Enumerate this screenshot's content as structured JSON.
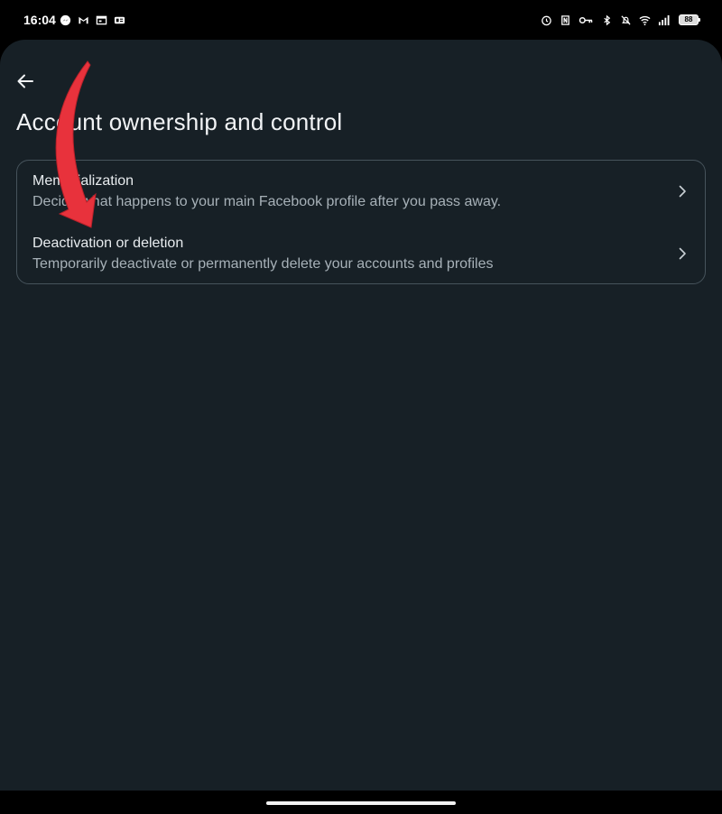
{
  "status_bar": {
    "time": "16:04",
    "left_icons": [
      "messenger-icon",
      "gmail-icon",
      "calendar-icon",
      "news-icon"
    ],
    "right_icons": [
      "alarm-icon",
      "nfc-icon",
      "key-icon",
      "bluetooth-icon",
      "mute-icon",
      "wifi-icon",
      "signal-icon"
    ],
    "battery_level": "88"
  },
  "header": {
    "back_icon": "back-arrow-icon",
    "title": "Account ownership and control"
  },
  "settings": {
    "items": [
      {
        "title": "Memorialization",
        "description": "Decide what happens to your main Facebook profile after you pass away.",
        "icon": "chevron-right-icon"
      },
      {
        "title": "Deactivation or deletion",
        "description": "Temporarily deactivate or permanently delete your accounts and profiles",
        "icon": "chevron-right-icon"
      }
    ]
  },
  "colors": {
    "background": "#172026",
    "card_border": "#46535b",
    "primary_text": "#e8ecef",
    "secondary_text": "#a7b1b8",
    "annotation_arrow": "#e8323c"
  }
}
